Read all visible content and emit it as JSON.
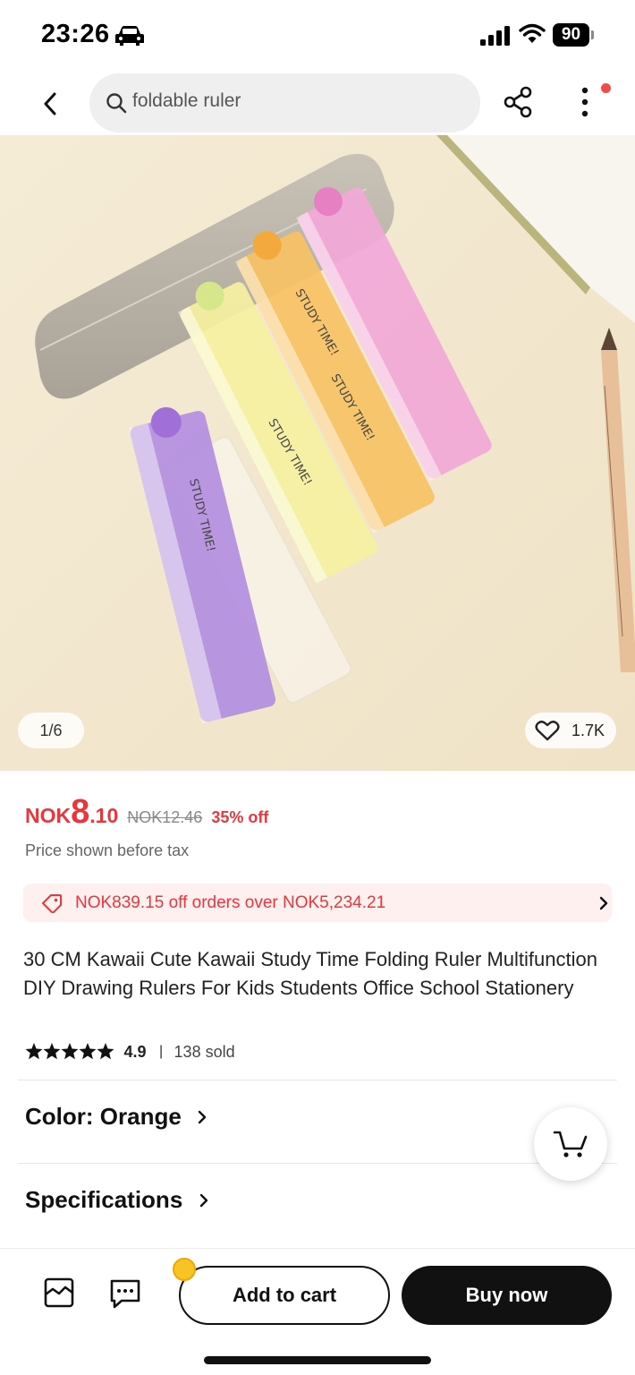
{
  "status_bar": {
    "time": "23:26",
    "battery": "90"
  },
  "nav": {
    "search_query": "foldable ruler"
  },
  "gallery": {
    "counter": "1/6",
    "likes": "1.7K"
  },
  "price": {
    "currency": "NOK",
    "major": "8",
    "minor": ".10",
    "original": "NOK12.46",
    "discount": "35% off",
    "tax_note": "Price shown before tax"
  },
  "coupon": {
    "text": "NOK839.15 off orders over NOK5,234.21"
  },
  "product": {
    "title": "30 CM Kawaii Cute Kawaii Study Time  Folding Ruler Multifunction DIY Drawing Rulers For Kids Students Office School Stationery",
    "rating": "4.9",
    "separator": "|",
    "sold": "138 sold"
  },
  "sections": {
    "color": "Color: Orange",
    "specifications": "Specifications"
  },
  "bottom_bar": {
    "add_to_cart": "Add to cart",
    "buy_now": "Buy now"
  },
  "image_text": {
    "study_time": "STUDY TIME!"
  },
  "colors": {
    "accent_red": "#e8363d",
    "coupon_bg": "#fff0f0",
    "ruler_purple": "#b48fe0",
    "ruler_yellow": "#f5f0a0",
    "ruler_orange": "#f7c264",
    "ruler_pink": "#f2a8d8"
  }
}
